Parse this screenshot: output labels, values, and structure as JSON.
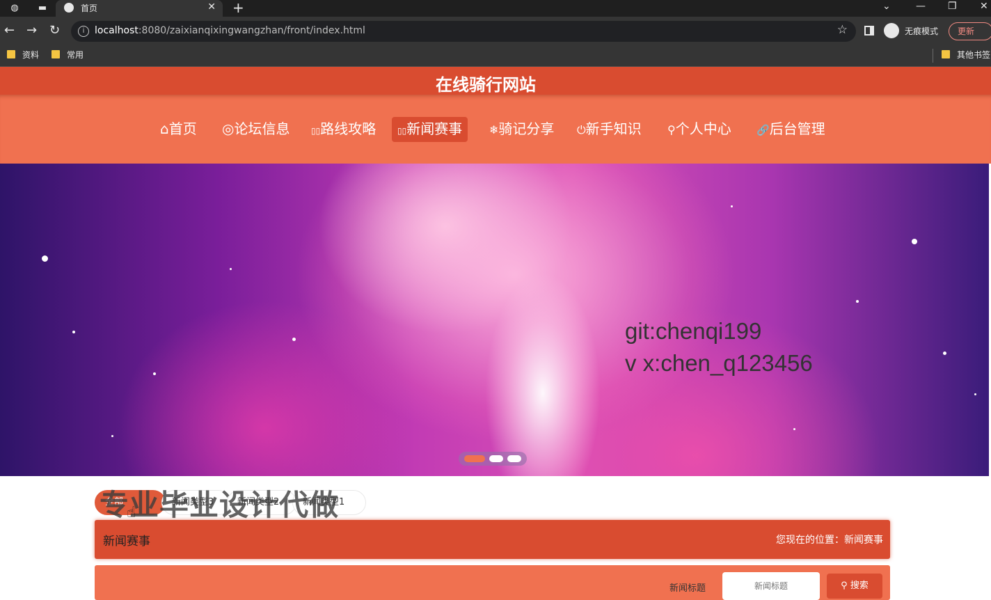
{
  "browser": {
    "tab_title": "首页",
    "url_host": "localhost",
    "url_rest": ":8080/zaixianqixingwangzhan/front/index.html",
    "incognito_label": "无痕模式",
    "update_label": "更新",
    "bookmarks": [
      "资料",
      "常用"
    ],
    "other_bookmarks": "其他书签"
  },
  "site": {
    "title": "在线骑行网站",
    "nav": [
      {
        "icon": "⌂",
        "label": "首页"
      },
      {
        "icon": "◎",
        "label": "论坛信息"
      },
      {
        "icon": "▯▯",
        "label": "路线攻略"
      },
      {
        "icon": "▯▯",
        "label": "新闻赛事"
      },
      {
        "icon": "❄",
        "label": "骑记分享"
      },
      {
        "icon": "⏻",
        "label": "新手知识"
      },
      {
        "icon": "⚲",
        "label": "个人中心"
      },
      {
        "icon": "🔗",
        "label": "后台管理"
      }
    ],
    "active_nav": "新闻赛事"
  },
  "banner": {
    "line1": "git:chenqi199",
    "line2": "v x:chen_q123456",
    "slide_count": 3,
    "active_slide": 1
  },
  "news": {
    "type_tabs": [
      "全部",
      "新闻类型3",
      "新闻类型2",
      "新闻类型1"
    ],
    "active_tab": "全部",
    "watermark": "专业毕业设计代做",
    "section_title": "新闻赛事",
    "location_label": "您现在的位置：新闻赛事",
    "search_label": "新闻标题",
    "search_placeholder": "新闻标题",
    "search_button": "搜索"
  },
  "colors": {
    "header": "#d94c30",
    "nav": "#f07150",
    "accent": "#e05a3a"
  }
}
